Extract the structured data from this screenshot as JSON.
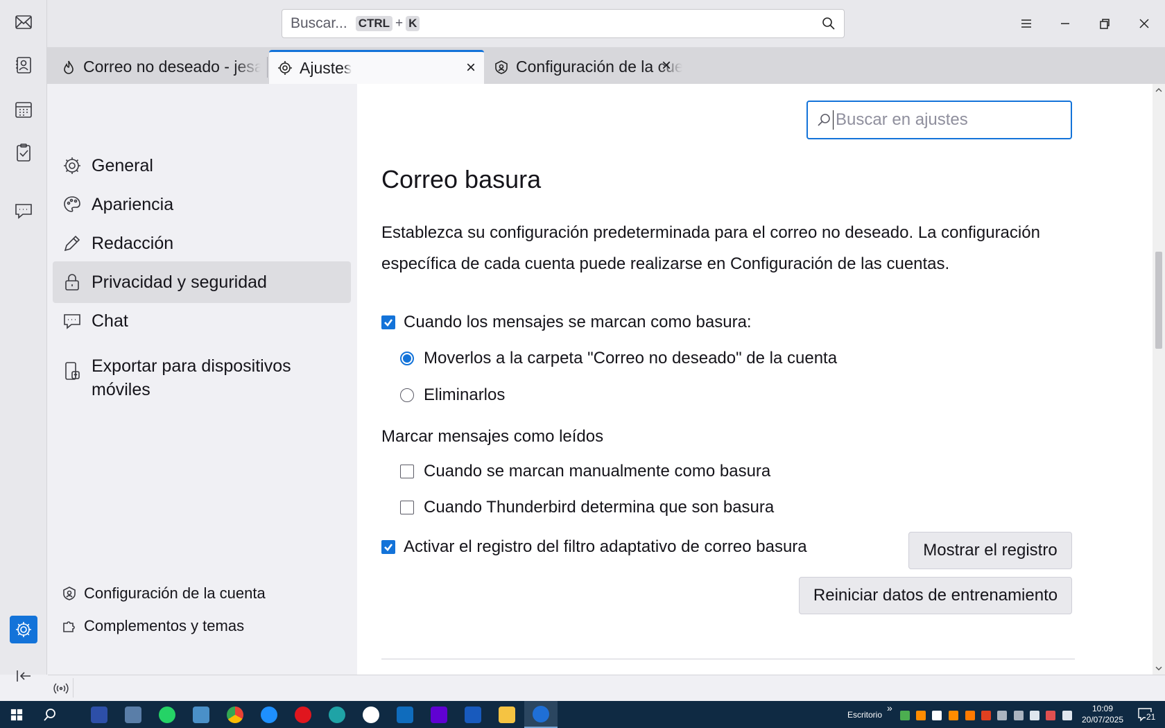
{
  "titlebar": {
    "search_placeholder": "Buscar...",
    "shortcut_key1": "CTRL",
    "shortcut_plus": "+",
    "shortcut_key2": "K"
  },
  "tabs": [
    {
      "label": "Correo no deseado - jesav",
      "icon": "junk-flame-icon"
    },
    {
      "label": "Ajustes",
      "icon": "gear-icon",
      "selected": true
    },
    {
      "label": "Configuración de la cue",
      "icon": "account-settings-icon"
    }
  ],
  "nav": {
    "categories": [
      {
        "label": "General",
        "icon": "gear-icon"
      },
      {
        "label": "Apariencia",
        "icon": "palette-icon"
      },
      {
        "label": "Redacción",
        "icon": "pencil-icon"
      },
      {
        "label": "Privacidad y seguridad",
        "icon": "lock-icon",
        "selected": true
      },
      {
        "label": "Chat",
        "icon": "chat-icon"
      },
      {
        "label": "Exportar para dispositivos móviles",
        "icon": "mobile-export-icon"
      }
    ],
    "bottom_links": [
      {
        "label": "Configuración de la cuenta",
        "icon": "account-settings-icon"
      },
      {
        "label": "Complementos y temas",
        "icon": "puzzle-icon"
      }
    ]
  },
  "content": {
    "search_placeholder": "Buscar en ajustes",
    "section_title": "Correo basura",
    "description": "Establezca su configuración predeterminada para el correo no deseado. La configuración específica de cada cuenta puede realizarse en Configuración de las cuentas.",
    "when_marked_label": "Cuando los mensajes se marcan como basura:",
    "when_marked_checked": true,
    "move_option": "Moverlos a la carpeta \"Correo no deseado\" de la cuenta",
    "delete_option": "Eliminarlos",
    "selected_option": "move",
    "mark_read_heading": "Marcar mensajes como leídos",
    "manual_label": "Cuando se marcan manualmente como basura",
    "manual_checked": false,
    "auto_label": "Cuando Thunderbird determina que son basura",
    "auto_checked": false,
    "log_label": "Activar el registro del filtro adaptativo de correo basura",
    "log_checked": true,
    "show_log_button": "Mostrar el registro",
    "reset_button": "Reiniciar datos de entrenamiento"
  },
  "taskbar": {
    "desktop_label": "Escritorio",
    "time": "10:09",
    "date": "20/07/2025",
    "notifications": "21"
  },
  "colors": {
    "accent": "#1373d9",
    "taskbar": "#0f2a43"
  }
}
